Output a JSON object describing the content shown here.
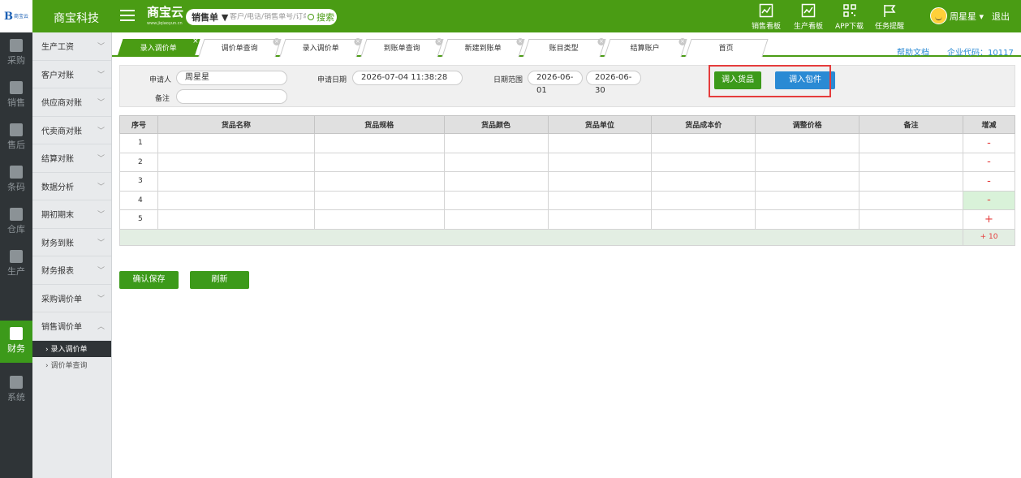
{
  "header": {
    "company": "商宝科技",
    "brand": "商宝云",
    "brand_sub": "www.jiqiaoyun.cn",
    "search_type": "销售单 ▼",
    "search_placeholder": "客户/电话/销售单号/订单号",
    "search_button": "搜索",
    "tools": [
      {
        "label": "销售看板",
        "icon": "chart-line-icon"
      },
      {
        "label": "生产看板",
        "icon": "chart-line-icon"
      },
      {
        "label": "APP下载",
        "icon": "qrcode-icon"
      },
      {
        "label": "任务提醒",
        "icon": "flag-icon"
      }
    ],
    "user_name": "周星星 ▾",
    "logout": "退出"
  },
  "iconbar": [
    {
      "label": "采购",
      "icon": "cart-icon"
    },
    {
      "label": "销售",
      "icon": "grid-icon"
    },
    {
      "label": "售后",
      "icon": "grid-icon"
    },
    {
      "label": "条码",
      "icon": "barcode-icon"
    },
    {
      "label": "仓库",
      "icon": "warehouse-icon"
    },
    {
      "label": "生产",
      "icon": "robot-arm-icon"
    },
    {
      "label": "财务",
      "icon": "calculator-icon"
    },
    {
      "label": "系统",
      "icon": "gear-icon"
    }
  ],
  "subbar": {
    "items": [
      "生产工资",
      "客户对账",
      "供应商对账",
      "代卖商对账",
      "结算对账",
      "数据分析",
      "期初期末",
      "财务到账",
      "财务报表",
      "采购调价单",
      "销售调价单"
    ],
    "children": [
      "› 录入调价单",
      "› 调价单查询"
    ]
  },
  "tabs": [
    "录入调价单",
    "调价单查询",
    "录入调价单",
    "到账单查询",
    "新建到账单",
    "账目类型",
    "结算账户",
    "首页"
  ],
  "top_links": {
    "help": "帮助文档",
    "code": "企业代码：10117"
  },
  "form": {
    "applicant_label": "申请人",
    "applicant_value": "周星星",
    "remark_label": "备注",
    "remark_value": "",
    "date_label": "申请日期",
    "date_value": "2026-07-04 11:38:28",
    "range_label": "日期范围",
    "range_start": "2026-06-01",
    "range_end": "2026-06-30",
    "import_goods": "调入货品",
    "import_package": "调入包件"
  },
  "table": {
    "columns": [
      "序号",
      "货品名称",
      "货品规格",
      "货品颜色",
      "货品单位",
      "货品成本价",
      "调整价格",
      "备注",
      "增减"
    ],
    "rows": [
      {
        "idx": "1",
        "op": "-"
      },
      {
        "idx": "2",
        "op": "-"
      },
      {
        "idx": "3",
        "op": "-"
      },
      {
        "idx": "4",
        "op": "-"
      },
      {
        "idx": "5",
        "op": "+"
      }
    ],
    "footer_op": "+ 10"
  },
  "actions": {
    "save": "确认保存",
    "refresh": "刷新"
  }
}
